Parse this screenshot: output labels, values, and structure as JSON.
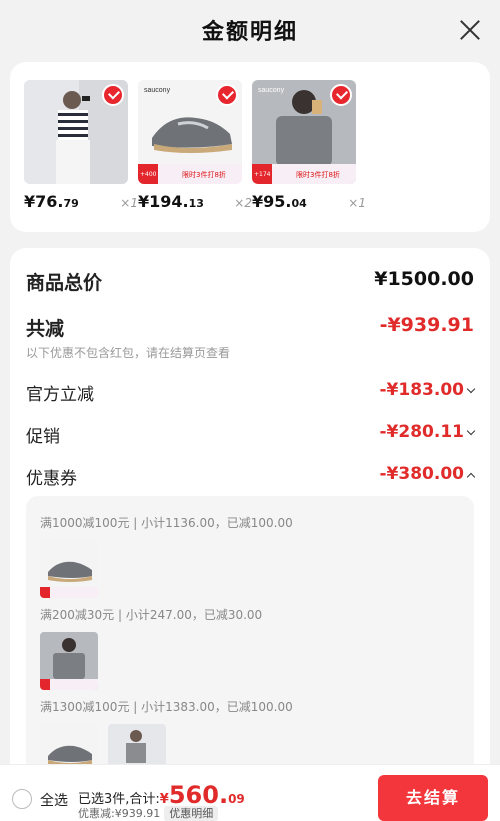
{
  "header": {
    "title": "金额明细"
  },
  "products": [
    {
      "price_int": "¥76.",
      "price_dec": "79",
      "qty": "×1",
      "kind": "woman-striped-shirt"
    },
    {
      "price_int": "¥194.",
      "price_dec": "13",
      "qty": "×2",
      "kind": "saucony-sneaker",
      "brand": "saucony",
      "promo_left": "+400",
      "promo_right": "限时3件打8折"
    },
    {
      "price_int": "¥95.",
      "price_dec": "04",
      "qty": "×1",
      "kind": "man-gray-tee",
      "brand": "saucony",
      "promo_left": "+174",
      "promo_right": "限时3件打8折"
    }
  ],
  "summary": {
    "total_label": "商品总价",
    "total_value": "¥1500.00",
    "discount_label": "共减",
    "discount_value": "-¥939.91",
    "discount_note": "以下优惠不包含红包，请在结算页查看",
    "lines": [
      {
        "label": "官方立减",
        "value": "-¥183.00"
      },
      {
        "label": "促销",
        "value": "-¥280.11"
      },
      {
        "label": "优惠券",
        "value": "-¥380.00"
      }
    ]
  },
  "coupons": [
    {
      "text": "满1000减100元 | 小计1136.00，已减100.00"
    },
    {
      "text": "满200减30元 | 小计247.00，已减30.00"
    },
    {
      "text": "满1300减100元 | 小计1383.00，已减100.00"
    }
  ],
  "bottom": {
    "select_all": "全选",
    "selected_text": "已选3件,合计:",
    "currency": "¥",
    "total_int": "560.",
    "total_dec": "09",
    "discount_text": "优惠减:¥939.91",
    "detail_link": "优惠明细",
    "checkout": "去结算"
  },
  "colors": {
    "accent": "#e12b2b",
    "checkout": "#f2363b",
    "background": "#f2f2f2"
  }
}
